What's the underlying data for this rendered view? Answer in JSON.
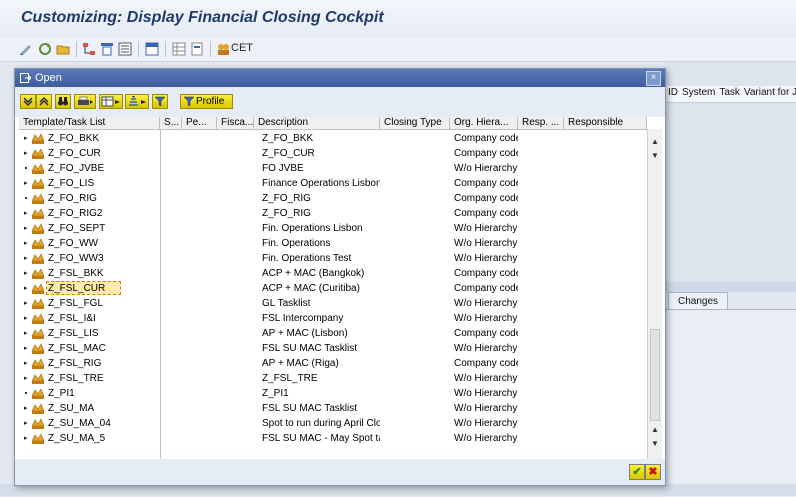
{
  "window": {
    "title": "Customizing: Display Financial Closing Cockpit",
    "toolbar_cet_label": "CET"
  },
  "background": {
    "header_columns": [
      "ID",
      "System",
      "Task",
      "Variant for J"
    ],
    "tab_label": "Changes"
  },
  "dialog": {
    "title": "Open",
    "close_glyph": "×",
    "toolbar": {
      "profile_label": "Profile"
    },
    "columns": [
      "Template/Task List",
      "S...",
      "Pe...",
      "Fisca...",
      "Description",
      "Closing Type",
      "Org. Hiera...",
      "Resp. ...",
      "Responsible"
    ],
    "rows": [
      {
        "name": "Z_FO_BKK",
        "expander": "▸",
        "description": "Z_FO_BKK",
        "org_hierarchy": "Company code"
      },
      {
        "name": "Z_FO_CUR",
        "expander": "▸",
        "description": "Z_FO_CUR",
        "org_hierarchy": "Company code"
      },
      {
        "name": "Z_FO_JVBE",
        "expander": "•",
        "description": "FO JVBE",
        "org_hierarchy": "W/o Hierarchy"
      },
      {
        "name": "Z_FO_LIS",
        "expander": "▸",
        "description": "Finance Operations Lisbon",
        "org_hierarchy": "Company code"
      },
      {
        "name": "Z_FO_RIG",
        "expander": "•",
        "description": "Z_FO_RIG",
        "org_hierarchy": "Company code"
      },
      {
        "name": "Z_FO_RIG2",
        "expander": "▸",
        "description": "Z_FO_RIG",
        "org_hierarchy": "Company code"
      },
      {
        "name": "Z_FO_SEPT",
        "expander": "▸",
        "description": "Fin. Operations Lisbon",
        "org_hierarchy": "W/o Hierarchy"
      },
      {
        "name": "Z_FO_WW",
        "expander": "▸",
        "description": "Fin. Operations",
        "org_hierarchy": "W/o Hierarchy"
      },
      {
        "name": "Z_FO_WW3",
        "expander": "▸",
        "description": "Fin. Operations Test",
        "org_hierarchy": "W/o Hierarchy"
      },
      {
        "name": "Z_FSL_BKK",
        "expander": "▸",
        "description": "ACP + MAC (Bangkok)",
        "org_hierarchy": "Company code"
      },
      {
        "name": "Z_FSL_CUR",
        "expander": "▸",
        "description": "ACP + MAC (Curitiba)",
        "org_hierarchy": "Company code",
        "selected": true
      },
      {
        "name": "Z_FSL_FGL",
        "expander": "▸",
        "description": "GL Tasklist",
        "org_hierarchy": "W/o Hierarchy"
      },
      {
        "name": "Z_FSL_I&I",
        "expander": "▸",
        "description": "FSL Intercompany",
        "org_hierarchy": "W/o Hierarchy"
      },
      {
        "name": "Z_FSL_LIS",
        "expander": "▸",
        "description": "AP + MAC (Lisbon)",
        "org_hierarchy": "Company code"
      },
      {
        "name": "Z_FSL_MAC",
        "expander": "▸",
        "description": "FSL SU MAC Tasklist",
        "org_hierarchy": "W/o Hierarchy"
      },
      {
        "name": "Z_FSL_RIG",
        "expander": "▸",
        "description": "AP + MAC (Riga)",
        "org_hierarchy": "Company code"
      },
      {
        "name": "Z_FSL_TRE",
        "expander": "▸",
        "description": "Z_FSL_TRE",
        "org_hierarchy": "W/o Hierarchy"
      },
      {
        "name": "Z_PI1",
        "expander": "•",
        "description": "Z_PI1",
        "org_hierarchy": "W/o Hierarchy"
      },
      {
        "name": "Z_SU_MA",
        "expander": "▸",
        "description": "FSL SU MAC Tasklist",
        "org_hierarchy": "W/o Hierarchy"
      },
      {
        "name": "Z_SU_MA_04",
        "expander": "▸",
        "description": "Spot to run during April Clo",
        "org_hierarchy": "W/o Hierarchy"
      },
      {
        "name": "Z_SU_MA_5",
        "expander": "▸",
        "description": "FSL SU MAC - May Spot tas",
        "org_hierarchy": "W/o Hierarchy"
      }
    ],
    "footer": {
      "ok_glyph": "✔",
      "cancel_glyph": "✖"
    }
  },
  "colors": {
    "dialog_title_bg": "#3c5c9d",
    "window_title_text": "#1e3a6a",
    "button_yellow": "#e8dc20",
    "selection_border": "#d08000"
  }
}
